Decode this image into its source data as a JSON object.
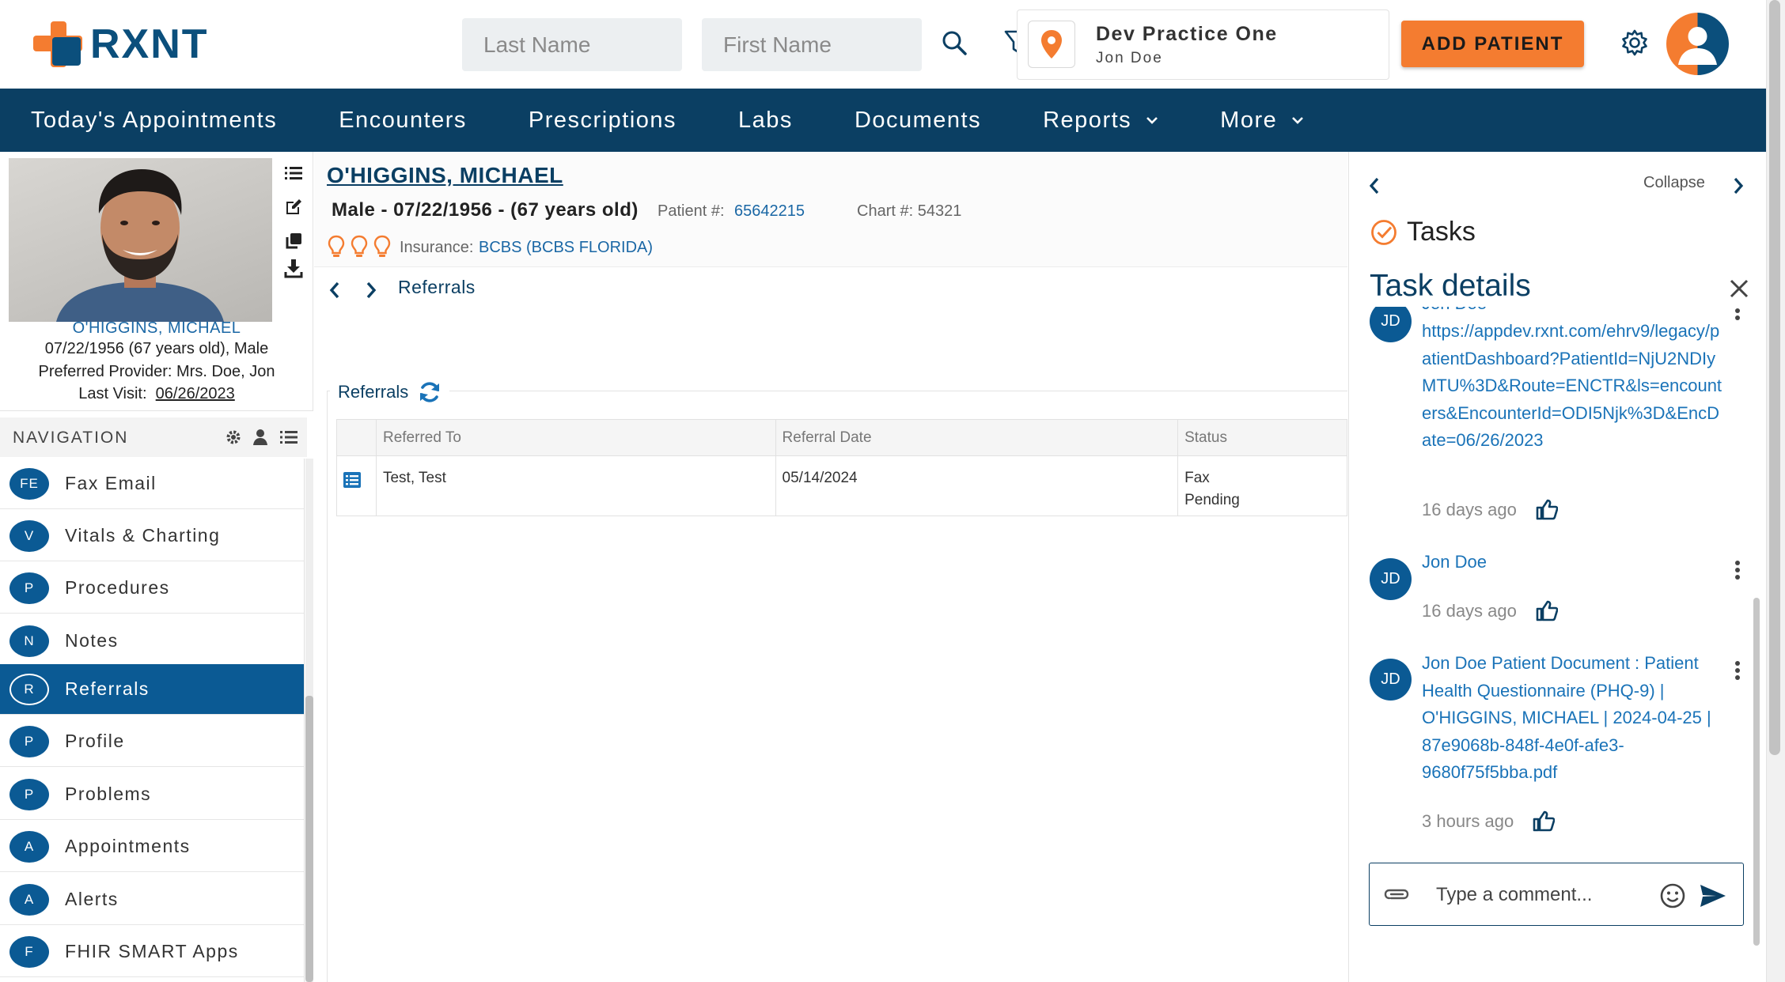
{
  "header": {
    "logo_text": "RXNT",
    "last_name_placeholder": "Last Name",
    "first_name_placeholder": "First Name",
    "practice_name": "Dev Practice One",
    "practice_user": "Jon Doe",
    "add_patient_label": "ADD PATIENT"
  },
  "nav": {
    "items": [
      {
        "label": "Today's Appointments"
      },
      {
        "label": "Encounters"
      },
      {
        "label": "Prescriptions"
      },
      {
        "label": "Labs"
      },
      {
        "label": "Documents"
      },
      {
        "label": "Reports"
      },
      {
        "label": "More"
      }
    ]
  },
  "patient_card": {
    "name": "O'HIGGINS, MICHAEL",
    "dob_line": "07/22/1956 (67 years old), Male",
    "provider_line": "Preferred Provider: Mrs. Doe, Jon",
    "last_visit_label": "Last Visit:",
    "last_visit_date": "06/26/2023"
  },
  "side_nav": {
    "title": "NAVIGATION",
    "items": [
      {
        "badge": "FE",
        "label": "Fax Email"
      },
      {
        "badge": "V",
        "label": "Vitals & Charting"
      },
      {
        "badge": "P",
        "label": "Procedures"
      },
      {
        "badge": "N",
        "label": "Notes"
      },
      {
        "badge": "R",
        "label": "Referrals",
        "active": true
      },
      {
        "badge": "P",
        "label": "Profile"
      },
      {
        "badge": "P",
        "label": "Problems"
      },
      {
        "badge": "A",
        "label": "Appointments"
      },
      {
        "badge": "A",
        "label": "Alerts"
      },
      {
        "badge": "F",
        "label": "FHIR SMART Apps"
      }
    ]
  },
  "patient_header": {
    "name": "O'HIGGINS, MICHAEL",
    "demographics": "Male - 07/22/1956 - (67 years old)",
    "patient_num_label": "Patient #:",
    "patient_num": "65642215",
    "chart_num": "Chart #: 54321",
    "insurance_label": "Insurance:",
    "insurance": "BCBS (BCBS FLORIDA)"
  },
  "breadcrumb": {
    "label": "Referrals"
  },
  "referrals": {
    "title": "Referrals",
    "columns": [
      "Referred To",
      "Referral Date",
      "Status"
    ],
    "rows": [
      {
        "referred_to": "Test, Test",
        "date": "05/14/2024",
        "status_line1": "Fax",
        "status_line2": "Pending"
      }
    ]
  },
  "right_panel": {
    "collapse_label": "Collapse",
    "tasks_title": "Tasks",
    "task_details_title": "Task details",
    "comments": [
      {
        "initials": "JD",
        "author": "Jon Doe",
        "text": "https://appdev.rxnt.com/ehrv9/legacy/patientDashboard?PatientId=NjU2NDIyMTU%3D&Route=ENCTR&ls=encounters&EncounterId=ODI5Njk%3D&EncDate=06/26/2023",
        "time": "16 days ago"
      },
      {
        "initials": "JD",
        "author": "Jon Doe",
        "text": "",
        "time": "16 days ago"
      },
      {
        "initials": "JD",
        "author": "",
        "text": "Jon Doe Patient Document : Patient Health Questionnaire (PHQ-9) | O'HIGGINS, MICHAEL | 2024-04-25 | 87e9068b-848f-4e0f-afe3-9680f75f5bba.pdf",
        "time": "3 hours ago"
      }
    ],
    "comment_placeholder": "Type a comment..."
  },
  "colors": {
    "brand_navy": "#0b3f63",
    "brand_orange": "#f47c30",
    "link_blue": "#1a73b8"
  }
}
